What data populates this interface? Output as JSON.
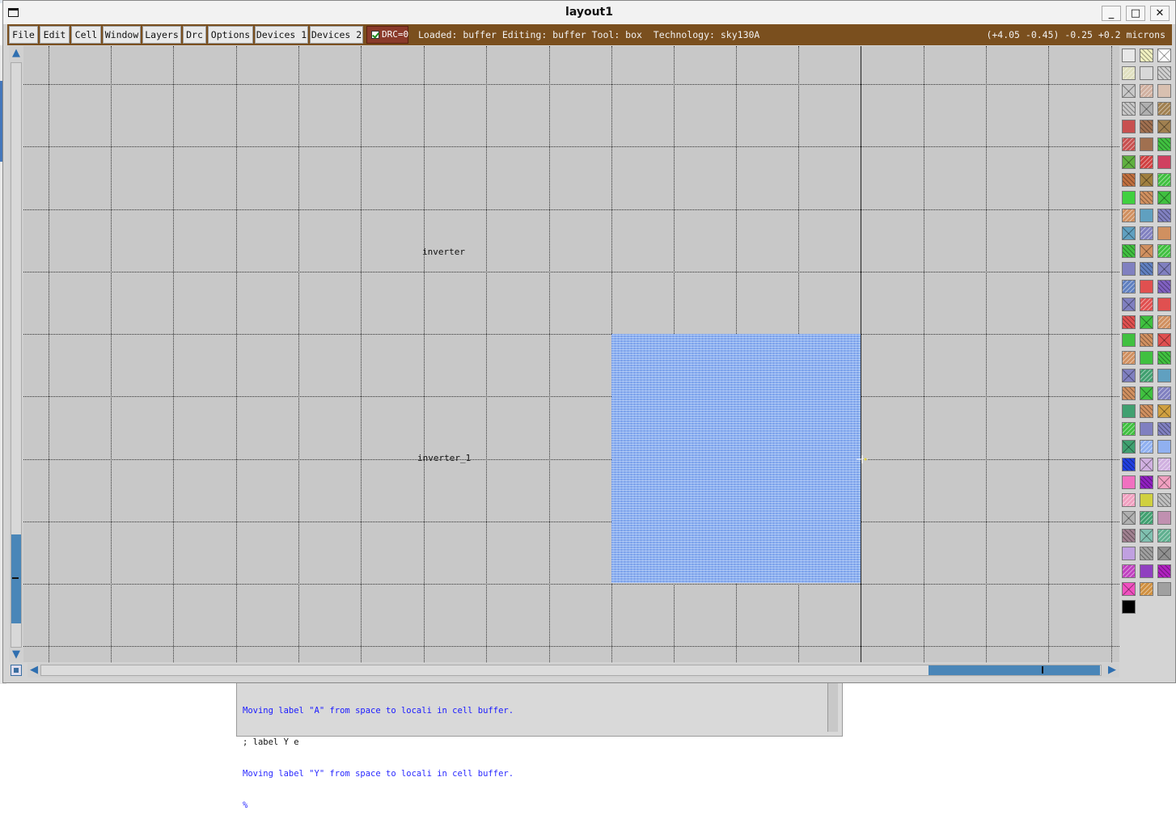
{
  "window": {
    "title": "layout1",
    "minimize": "_",
    "maximize": "□",
    "close": "✕"
  },
  "menu": {
    "items": [
      "File",
      "Edit",
      "Cell",
      "Window",
      "Layers",
      "Drc",
      "Options",
      "Devices 1",
      "Devices 2"
    ],
    "drc_label": "DRC=0",
    "drc_checked": true,
    "status": "Loaded: buffer Editing: buffer Tool: box  Technology: sky130A",
    "coords": "(+4.05 -0.45) -0.25 +0.2 microns"
  },
  "canvas": {
    "labels": {
      "inverter": "inverter",
      "inverter_1": "inverter_1"
    },
    "background": "#c8c8c8",
    "box_color": "#88aef0"
  },
  "console": {
    "lines": [
      {
        "text": "Moving label \"A\" from space to locali in cell buffer.",
        "kind": "info"
      },
      {
        "text": "; label Y e",
        "kind": "cmd"
      },
      {
        "text": "Moving label \"Y\" from space to locali in cell buffer.",
        "kind": "info"
      },
      {
        "text": "%",
        "kind": "prompt"
      }
    ]
  },
  "icons": {
    "scroll_up": "arrow-up-icon",
    "scroll_down": "arrow-down-icon",
    "scroll_left": "arrow-left-icon",
    "scroll_right": "arrow-right-icon",
    "zoom_box": "zoom-box-icon",
    "window_icon": "window-icon"
  },
  "palette": {
    "colors": [
      "#e8e8e8",
      "#f0f0c0",
      "#ffffff",
      "#e0e0c0",
      "#d8d8d8",
      "#d0d0d0",
      "#c8c8c8",
      "#d0b0a0",
      "#d8c0b0",
      "#c8c8c8",
      "#b0b0b0",
      "#a08050",
      "#c85050",
      "#a07050",
      "#a08050",
      "#c85050",
      "#a07050",
      "#40c040",
      "#60b040",
      "#d04040",
      "#d04060",
      "#c07040",
      "#a08040",
      "#40c040",
      "#40d040",
      "#d09060",
      "#40c040",
      "#d09060",
      "#60a0c0",
      "#8080c0",
      "#60a0c0",
      "#8080c0",
      "#d09060",
      "#40c040",
      "#d09060",
      "#40c040",
      "#8080c0",
      "#6080c0",
      "#8080c0",
      "#6080c0",
      "#e05050",
      "#8060c0",
      "#8080c0",
      "#e05050",
      "#e05050",
      "#e05050",
      "#40c040",
      "#d09060",
      "#40c040",
      "#d09060",
      "#e05050",
      "#d09060",
      "#40c040",
      "#40c040",
      "#8080c0",
      "#40a070",
      "#60a0c0",
      "#d09060",
      "#40c040",
      "#8080c0",
      "#40a070",
      "#d09060",
      "#d0a040",
      "#40c040",
      "#8080c0",
      "#8080c0",
      "#40a070",
      "#90b0f0",
      "#90b0f0",
      "#2040e0",
      "#d0b0e0",
      "#d0b0e0",
      "#f070c0",
      "#9020c0",
      "#f0a0c0",
      "#f0a0c0",
      "#d0d040",
      "#c0c0c0",
      "#b0b0b0",
      "#40a070",
      "#c090b0",
      "#a08090",
      "#80c0b0",
      "#60b090",
      "#c0a0e0",
      "#a0a0a0",
      "#909090",
      "#c040c0",
      "#9040c0",
      "#b020c0",
      "#f050c0",
      "#d09040",
      "#a0a0a0",
      "#000000"
    ]
  }
}
